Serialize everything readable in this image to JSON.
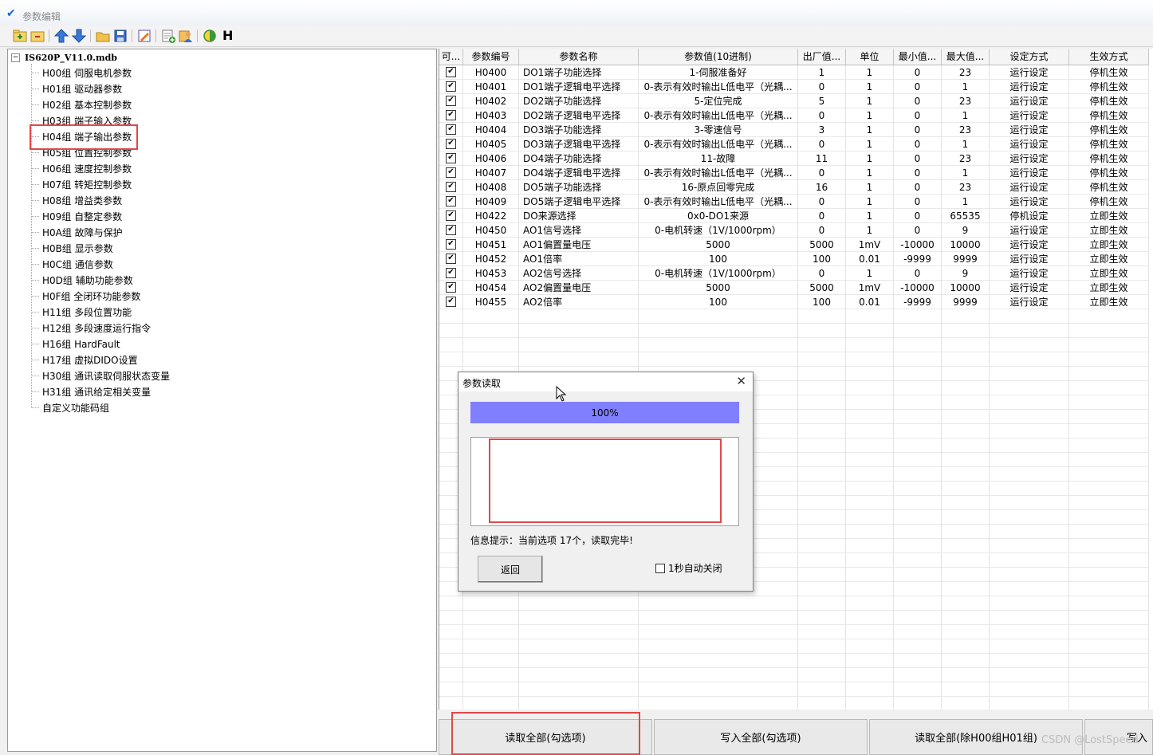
{
  "window": {
    "title": "参数编辑"
  },
  "toolbar": {
    "icons": [
      "new-icon",
      "close-file-icon",
      "move-up-icon",
      "move-down-icon",
      "open-folder-icon",
      "save-icon",
      "edit-icon",
      "add-icon",
      "user-icon",
      "contrast-icon"
    ],
    "h_label": "H"
  },
  "tree": {
    "root": "IS620P_V11.0.mdb",
    "items": [
      "H00组 伺服电机参数",
      "H01组 驱动器参数",
      "H02组 基本控制参数",
      "H03组 端子输入参数",
      "H04组 端子输出参数",
      "H05组 位置控制参数",
      "H06组 速度控制参数",
      "H07组 转矩控制参数",
      "H08组 增益类参数",
      "H09组 自整定参数",
      "H0A组 故障与保护",
      "H0B组 显示参数",
      "H0C组 通信参数",
      "H0D组 辅助功能参数",
      "H0F组 全闭环功能参数",
      "H11组 多段位置功能",
      "H12组 多段速度运行指令",
      "H16组 HardFault",
      "H17组 虚拟DIDO设置",
      "H30组 通讯读取伺服状态变量",
      "H31组 通讯给定相关变量",
      "自定义功能码组"
    ]
  },
  "grid": {
    "headers": [
      "可...",
      "参数编号",
      "参数名称",
      "参数值(10进制)",
      "出厂值...",
      "单位",
      "最小值...",
      "最大值...",
      "设定方式",
      "生效方式"
    ],
    "rows": [
      [
        "H0400",
        "DO1端子功能选择",
        "1-伺服准备好",
        "1",
        "1",
        "0",
        "23",
        "运行设定",
        "停机生效"
      ],
      [
        "H0401",
        "DO1端子逻辑电平选择",
        "0-表示有效时输出L低电平（光耦...",
        "0",
        "1",
        "0",
        "1",
        "运行设定",
        "停机生效"
      ],
      [
        "H0402",
        "DO2端子功能选择",
        "5-定位完成",
        "5",
        "1",
        "0",
        "23",
        "运行设定",
        "停机生效"
      ],
      [
        "H0403",
        "DO2端子逻辑电平选择",
        "0-表示有效时输出L低电平（光耦...",
        "0",
        "1",
        "0",
        "1",
        "运行设定",
        "停机生效"
      ],
      [
        "H0404",
        "DO3端子功能选择",
        "3-零速信号",
        "3",
        "1",
        "0",
        "23",
        "运行设定",
        "停机生效"
      ],
      [
        "H0405",
        "DO3端子逻辑电平选择",
        "0-表示有效时输出L低电平（光耦...",
        "0",
        "1",
        "0",
        "1",
        "运行设定",
        "停机生效"
      ],
      [
        "H0406",
        "DO4端子功能选择",
        "11-故障",
        "11",
        "1",
        "0",
        "23",
        "运行设定",
        "停机生效"
      ],
      [
        "H0407",
        "DO4端子逻辑电平选择",
        "0-表示有效时输出L低电平（光耦...",
        "0",
        "1",
        "0",
        "1",
        "运行设定",
        "停机生效"
      ],
      [
        "H0408",
        "DO5端子功能选择",
        "16-原点回零完成",
        "16",
        "1",
        "0",
        "23",
        "运行设定",
        "停机生效"
      ],
      [
        "H0409",
        "DO5端子逻辑电平选择",
        "0-表示有效时输出L低电平（光耦...",
        "0",
        "1",
        "0",
        "1",
        "运行设定",
        "停机生效"
      ],
      [
        "H0422",
        "DO来源选择",
        "0x0-DO1来源",
        "0",
        "1",
        "0",
        "65535",
        "停机设定",
        "立即生效"
      ],
      [
        "H0450",
        "AO1信号选择",
        "0-电机转速（1V/1000rpm）",
        "0",
        "1",
        "0",
        "9",
        "运行设定",
        "立即生效"
      ],
      [
        "H0451",
        "AO1偏置量电压",
        "5000",
        "5000",
        "1mV",
        "-10000",
        "10000",
        "运行设定",
        "立即生效"
      ],
      [
        "H0452",
        "AO1倍率",
        "100",
        "100",
        "0.01",
        "-9999",
        "9999",
        "运行设定",
        "立即生效"
      ],
      [
        "H0453",
        "AO2信号选择",
        "0-电机转速（1V/1000rpm）",
        "0",
        "1",
        "0",
        "9",
        "运行设定",
        "立即生效"
      ],
      [
        "H0454",
        "AO2偏置量电压",
        "5000",
        "5000",
        "1mV",
        "-10000",
        "10000",
        "运行设定",
        "立即生效"
      ],
      [
        "H0455",
        "AO2倍率",
        "100",
        "100",
        "0.01",
        "-9999",
        "9999",
        "运行设定",
        "立即生效"
      ]
    ]
  },
  "buttons": [
    "读取全部(勾选项)",
    "写入全部(勾选项)",
    "读取全部(除H00组H01组)",
    "写入"
  ],
  "watermark": "CSDN @LostSpeed",
  "dialog": {
    "title": "参数读取",
    "progress_text": "100%",
    "progress_value": 100,
    "info": "信息提示：当前选项 17个，读取完毕!",
    "back_label": "返回",
    "auto_close_label": "1秒自动关闭"
  },
  "colors": {
    "progress": "#7f7fff",
    "highlight": "#e04848"
  }
}
